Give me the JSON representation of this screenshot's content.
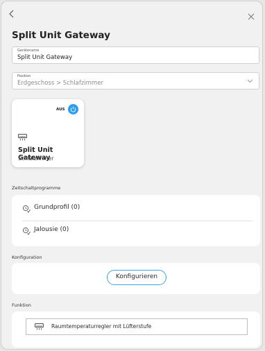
{
  "dialog": {
    "title": "Split Unit Gateway"
  },
  "fields": {
    "name": {
      "label": "Gerätename",
      "value": "Split Unit Gateway"
    },
    "position": {
      "label": "Position",
      "value": "Erdgeschoss > Schlafzimmer"
    }
  },
  "device_card": {
    "status": "AUS",
    "name": "Split Unit Gateway",
    "room": "Schlafzimmer",
    "power_color": "#2c9ef0"
  },
  "schedules": {
    "label": "Zeitschaltprogramme",
    "items": [
      {
        "label": "Grundprofil (0)"
      },
      {
        "label": "Jalousie (0)"
      }
    ]
  },
  "configuration": {
    "label": "Konfiguration",
    "button_label": "Konfigurieren",
    "accent": "#3aa3e8"
  },
  "function": {
    "label": "Funktion",
    "value": "Raumtemperaturregler mit Lüfterstufe"
  }
}
